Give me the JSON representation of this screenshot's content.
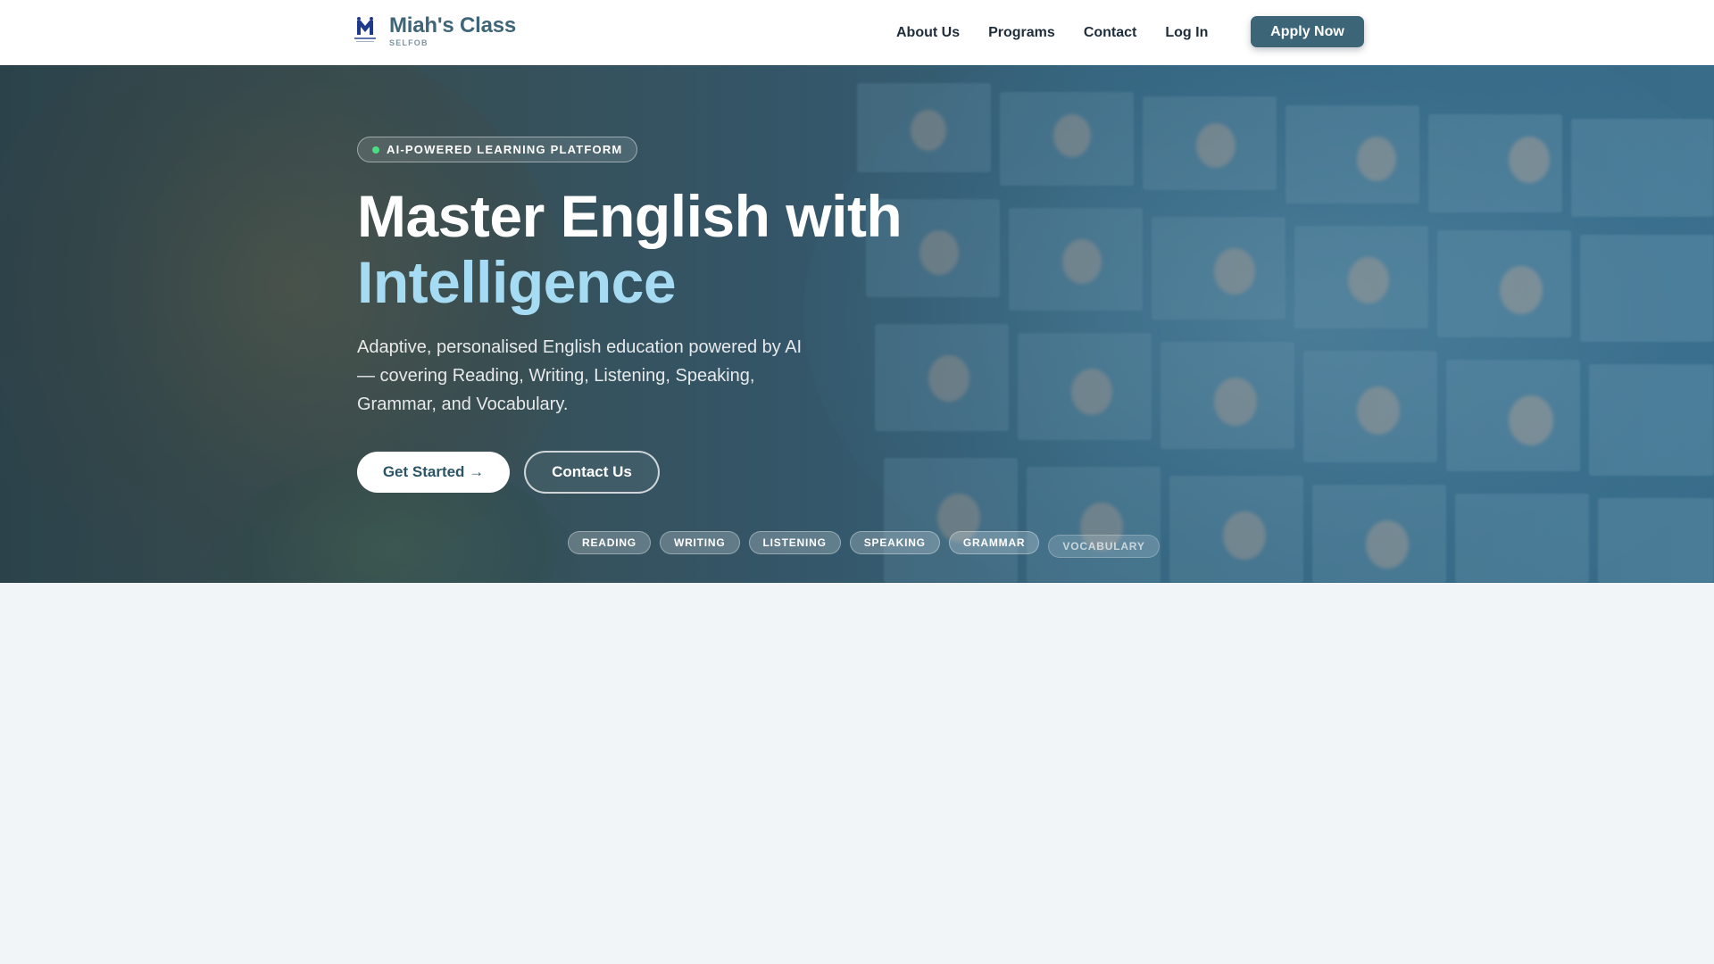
{
  "navbar": {
    "brand_name": "Miah's Class",
    "brand_sub": "SELFOB",
    "logo_text": "Miah's Class",
    "links": [
      "About Us",
      "Programs",
      "Contact",
      "Log In"
    ],
    "apply_label": "Apply Now"
  },
  "hero": {
    "badge": "AI-POWERED LEARNING PLATFORM",
    "title_line1": "Master English with",
    "title_line2": "Intelligence",
    "description": "Adaptive, personalised English education powered by AI — covering Reading, Writing, Listening, Speaking, Grammar, and Vocabulary.",
    "primary_cta": "Get Started →",
    "secondary_cta": "Contact Us",
    "skills": [
      "READING",
      "WRITING",
      "LISTENING",
      "SPEAKING",
      "GRAMMAR",
      "VOCABULARY"
    ]
  },
  "colors": {
    "brand": "#3f6578",
    "apply_button": "#3c6577",
    "accent_text": "#a6dcf3",
    "badge_dot": "#4ade80",
    "page_background": "#f1f5f8"
  }
}
